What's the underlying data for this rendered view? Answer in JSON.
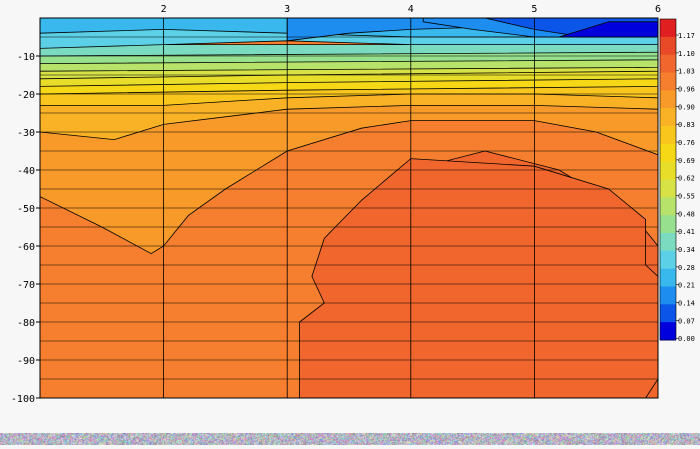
{
  "chart_data": {
    "type": "heatmap",
    "title": "",
    "xlabel": "",
    "ylabel": "",
    "x_ticks": [
      2,
      3,
      4,
      5,
      6
    ],
    "y_ticks": [
      -10,
      -20,
      -30,
      -40,
      -50,
      -60,
      -70,
      -80,
      -90,
      -100
    ],
    "y_tick_labels": [
      "-10",
      "-20",
      "-30",
      "-40",
      "-50",
      "-60",
      "-70",
      "-80",
      "-90",
      "-100"
    ],
    "xlim": [
      1,
      6
    ],
    "ylim": [
      -100,
      0
    ],
    "colorbar": {
      "ticks": [
        "1.17",
        "1.10",
        "1.03",
        "0.96",
        "0.90",
        "0.83",
        "0.76",
        "0.69",
        "0.62",
        "0.55",
        "0.48",
        "0.41",
        "0.34",
        "0.28",
        "0.21",
        "0.14",
        "0.07",
        "0.00"
      ],
      "colors": [
        "#e02020",
        "#e84a28",
        "#f0662c",
        "#f57f2e",
        "#f89a2a",
        "#f9b226",
        "#f9c61e",
        "#f6d817",
        "#e8de2a",
        "#d6e246",
        "#b7e36a",
        "#96e08e",
        "#7bdbc0",
        "#5cd0e6",
        "#38b8ec",
        "#1d8df0",
        "#0b56e8",
        "#0000dd"
      ]
    },
    "contour_levels": [
      {
        "value": 1.1,
        "points": [
          [
            5.2,
            0
          ],
          [
            5.2,
            -100
          ],
          [
            4,
            -100
          ],
          [
            3.3,
            -100
          ],
          [
            3.2,
            -100
          ],
          [
            3.2,
            -100
          ]
        ]
      }
    ],
    "grid": true,
    "legend": "right"
  }
}
